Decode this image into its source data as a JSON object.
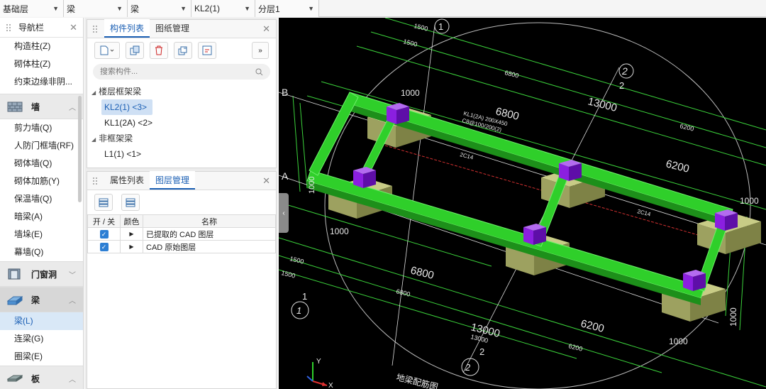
{
  "topbar": {
    "dropdowns": [
      {
        "value": "基础层"
      },
      {
        "value": "梁"
      },
      {
        "value": "梁"
      },
      {
        "value": "KL2(1)"
      },
      {
        "value": "分层1"
      }
    ]
  },
  "nav": {
    "title": "导航栏",
    "items_top": [
      "构造柱(Z)",
      "砌体柱(Z)",
      "约束边缘非阴..."
    ],
    "group_wall": "墙",
    "wall_items": [
      "剪力墙(Q)",
      "人防门框墙(RF)",
      "砌体墙(Q)",
      "砌体加筋(Y)",
      "保温墙(Q)",
      "暗梁(A)",
      "墙垛(E)",
      "幕墙(Q)"
    ],
    "group_door": "门窗洞",
    "group_beam": "梁",
    "beam_items": [
      "梁(L)",
      "连梁(G)",
      "圈梁(E)"
    ],
    "group_slab": "板"
  },
  "components": {
    "tab1": "构件列表",
    "tab2": "图纸管理",
    "search_placeholder": "搜索构件...",
    "cat1": "楼层框架梁",
    "cat1_items": [
      "KL2(1) <3>",
      "KL1(2A) <2>"
    ],
    "cat2": "非框架梁",
    "cat2_items": [
      "L1(1) <1>"
    ]
  },
  "layers": {
    "tab1": "属性列表",
    "tab2": "图层管理",
    "col_onoff": "开 / 关",
    "col_color": "颜色",
    "col_name": "名称",
    "rows": [
      {
        "name": "已提取的 CAD 图层"
      },
      {
        "name": "CAD 原始图层"
      }
    ]
  },
  "viewport": {
    "axis_b": "B",
    "axis_a": "A",
    "axis_1": "1",
    "axis_2": "2",
    "dim_6800": "6800",
    "dim_13000": "13000",
    "dim_6200": "6200",
    "dim_1500": "1500",
    "dim_1000": "1000",
    "beam_label_1": "KL1(2A) 200X450",
    "beam_label_2": "C8@100/200(2)",
    "beam_label_3": "2C14",
    "axis_label_y": "Y",
    "axis_label_x": "X",
    "drawing_title": "地梁配筋图",
    "colors": {
      "beam": "#2fcf2a",
      "column": "#8b1fe0",
      "footing": "#b8bd74",
      "dim": "#3bd23b"
    }
  }
}
